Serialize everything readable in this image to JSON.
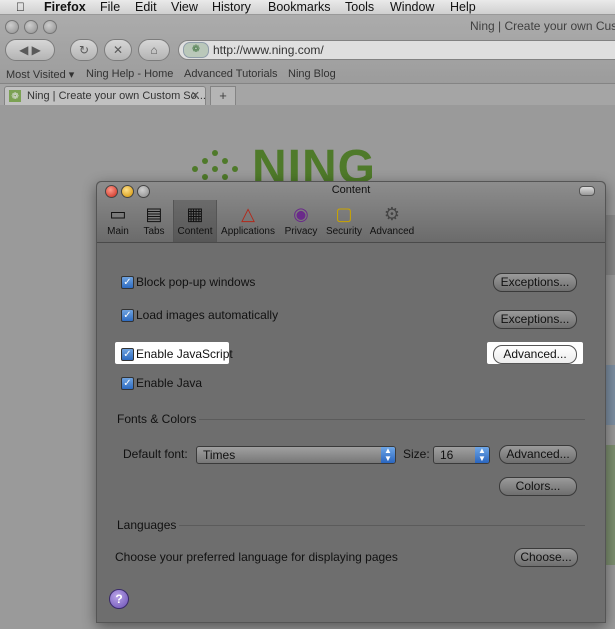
{
  "menubar": {
    "app": "Firefox",
    "items": [
      "File",
      "Edit",
      "View",
      "History",
      "Bookmarks",
      "Tools",
      "Window",
      "Help"
    ]
  },
  "browser": {
    "window_title": "Ning | Create your own Custo",
    "url": "http://www.ning.com/",
    "bookmarks": [
      "Most Visited ▾",
      "Ning Help - Home",
      "Advanced Tutorials",
      "Ning Blog"
    ],
    "tab_title": "Ning | Create your own Custom So...",
    "new_tab": "+",
    "page_logo": "NING"
  },
  "dialog": {
    "title": "Content",
    "toolbar": [
      {
        "label": "Main",
        "icon": "switch-icon"
      },
      {
        "label": "Tabs",
        "icon": "tabs-icon"
      },
      {
        "label": "Content",
        "icon": "content-icon"
      },
      {
        "label": "Applications",
        "icon": "applications-icon"
      },
      {
        "label": "Privacy",
        "icon": "privacy-mask-icon"
      },
      {
        "label": "Security",
        "icon": "lock-icon"
      },
      {
        "label": "Advanced",
        "icon": "gear-icon"
      }
    ],
    "options": {
      "block_popups": {
        "label": "Block pop-up windows",
        "checked": true,
        "button": "Exceptions..."
      },
      "load_images": {
        "label": "Load images automatically",
        "checked": true,
        "button": "Exceptions..."
      },
      "enable_js": {
        "label": "Enable JavaScript",
        "checked": true,
        "button": "Advanced..."
      },
      "enable_java": {
        "label": "Enable Java",
        "checked": true
      }
    },
    "fonts": {
      "section": "Fonts & Colors",
      "default_font_label": "Default font:",
      "default_font_value": "Times",
      "size_label": "Size:",
      "size_value": "16",
      "advanced_button": "Advanced...",
      "colors_button": "Colors..."
    },
    "languages": {
      "section": "Languages",
      "description": "Choose your preferred language for displaying pages",
      "choose_button": "Choose..."
    },
    "help": "?"
  },
  "colors": {
    "highlight": "#ffffff",
    "checkbox": "#2d6bc1",
    "logo": "#4f7a2a"
  }
}
